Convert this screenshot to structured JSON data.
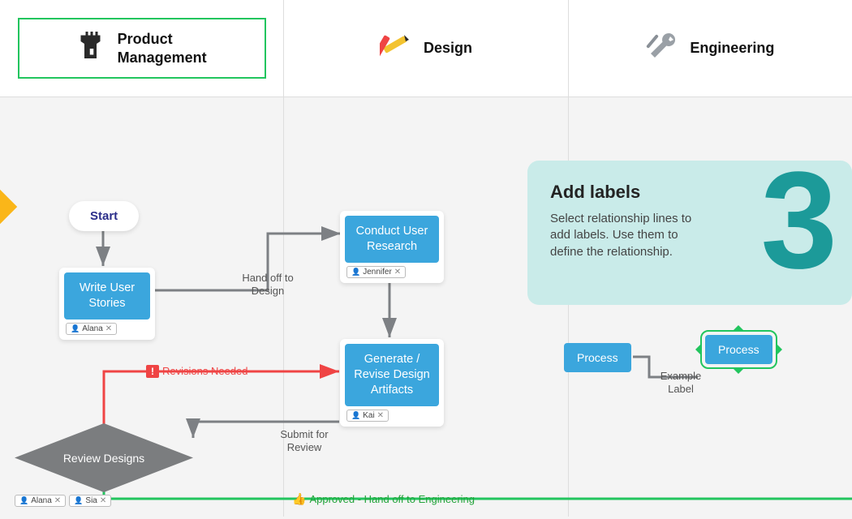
{
  "lanes": {
    "product": {
      "title": "Product\nManagement",
      "icon": "castle-icon"
    },
    "design": {
      "title": "Design",
      "icon": "pencil-ruler-icon"
    },
    "engineering": {
      "title": "Engineering",
      "icon": "wrench-screwdriver-icon"
    }
  },
  "nodes": {
    "start": {
      "label": "Start"
    },
    "write_stories": {
      "label": "Write User Stories",
      "assignees": [
        "Alana"
      ]
    },
    "conduct_research": {
      "label": "Conduct User Research",
      "assignees": [
        "Jennifer"
      ]
    },
    "generate_artifacts": {
      "label": "Generate / Revise Design Artifacts",
      "assignees": [
        "Kai"
      ]
    },
    "review_designs": {
      "label": "Review Designs",
      "assignees": [
        "Alana",
        "Sia"
      ]
    }
  },
  "edges": {
    "write_to_research": {
      "label": "Hand off to Design"
    },
    "artifacts_to_review": {
      "label": "Submit for Review"
    },
    "review_to_artifacts": {
      "label": "Revisions Needed",
      "style": "red"
    },
    "review_to_engineering": {
      "label": "Approved - Hand off to Engineering",
      "style": "green"
    }
  },
  "callout": {
    "step_number": "3",
    "title": "Add labels",
    "body": "Select relationship lines to add labels. Use them to define the relationship."
  },
  "example": {
    "process_a": "Process",
    "process_b": "Process",
    "edge_label": "Example Label"
  }
}
